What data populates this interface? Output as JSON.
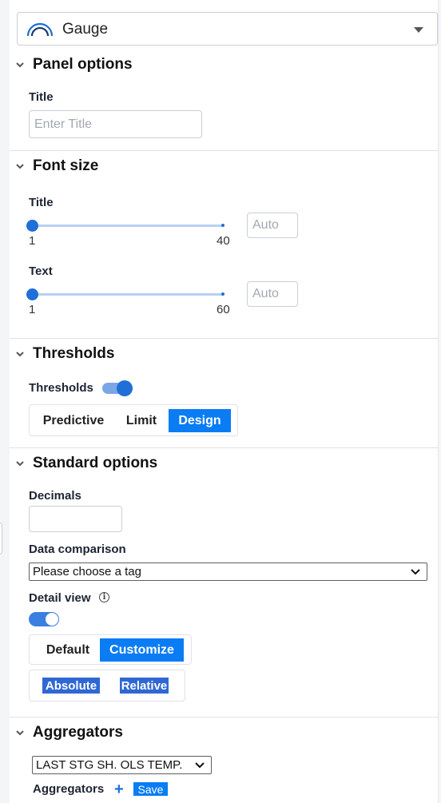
{
  "panel_type": {
    "label": "Gauge",
    "icon": "gauge-icon"
  },
  "panel_options": {
    "title": "Panel options",
    "title_label": "Title",
    "title_placeholder": "Enter Title"
  },
  "font_size": {
    "title": "Font size",
    "title_slider": {
      "label": "Title",
      "min": "1",
      "max": "40",
      "value": 1,
      "auto_placeholder": "Auto"
    },
    "text_slider": {
      "label": "Text",
      "min": "1",
      "max": "60",
      "value": 1,
      "auto_placeholder": "Auto"
    }
  },
  "thresholds": {
    "title": "Thresholds",
    "toggle_label": "Thresholds",
    "toggle_on": true,
    "modes": [
      "Predictive",
      "Limit",
      "Design"
    ],
    "active_mode": "Design"
  },
  "standard_options": {
    "title": "Standard options",
    "decimals_label": "Decimals",
    "decimals_value": "",
    "data_comparison_label": "Data comparison",
    "data_comparison_value": "Please choose a tag",
    "detail_view_label": "Detail view",
    "detail_view_on": true,
    "view_modes": [
      "Default",
      "Customize"
    ],
    "active_view_mode": "Customize",
    "scale_modes": [
      "Absolute",
      "Relative"
    ]
  },
  "aggregators": {
    "title": "Aggregators",
    "tag_select_value": "LAST STG SH. OLS TEMP.",
    "aggregators_label": "Aggregators",
    "add_icon": "plus-icon",
    "save_label": "Save"
  },
  "colors": {
    "accent": "#0a7cf4",
    "slider": "#1f6fd6",
    "highlight": "#2f68d3"
  }
}
